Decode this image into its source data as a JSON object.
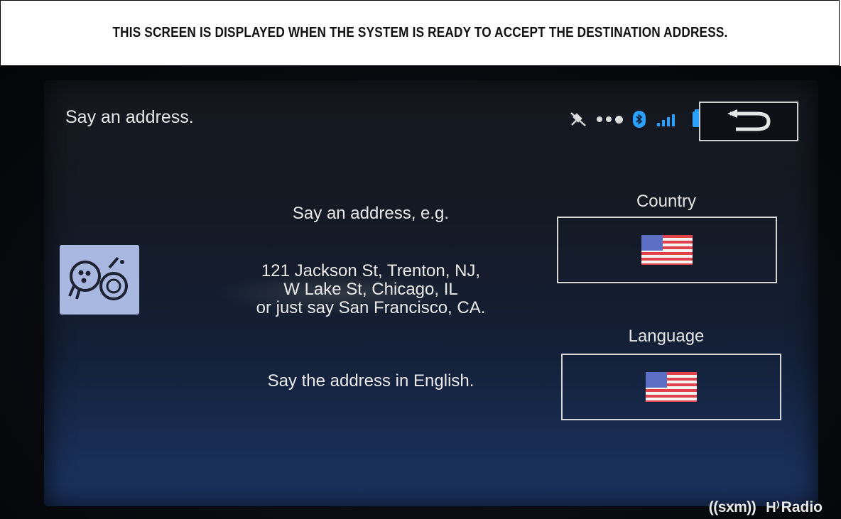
{
  "caption": {
    "text": "THIS SCREEN IS DISPLAYED WHEN THE SYSTEM IS READY TO ACCEPT THE DESTINATION ADDRESS."
  },
  "screen": {
    "title": "Say an address.",
    "status_icons": [
      "satellite-off-icon",
      "dots-indicator",
      "bluetooth-icon",
      "signal-strength-icon",
      "battery-icon"
    ],
    "back_icon": "back-arrow-icon",
    "voice_icon": "voice-recognition-icon",
    "prompt": "Say an address, e.g.",
    "examples": {
      "line1": "121 Jackson St, Trenton, NJ,",
      "line2": "W Lake St, Chicago, IL",
      "line3": "or just say San Francisco, CA."
    },
    "instruction": "Say the address in English.",
    "country": {
      "label": "Country",
      "flag_icon": "us-flag-icon"
    },
    "language": {
      "label": "Language",
      "flag_icon": "us-flag-icon"
    }
  },
  "logos": {
    "sxm": "((sxm))",
    "hd_radio": "Radio"
  },
  "colors": {
    "accent_blue": "#2aa0ff",
    "voice_icon_bg": "#a9b8e0"
  }
}
